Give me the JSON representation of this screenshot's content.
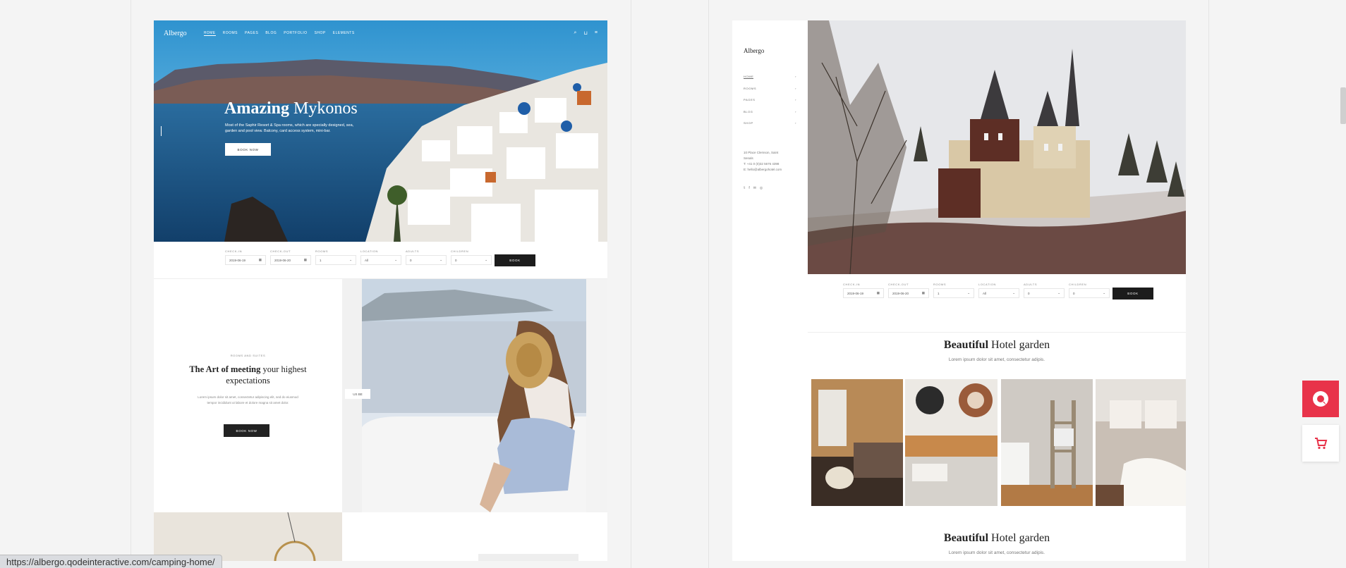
{
  "left_demo": {
    "nav": {
      "logo": "Albergo",
      "items": [
        "HOME",
        "ROOMS",
        "PAGES",
        "BLOG",
        "PORTFOLIO",
        "SHOP",
        "ELEMENTS"
      ]
    },
    "hero": {
      "title_bold": "Amazing",
      "title_rest": " Mykonos",
      "desc": "Most of the Saphir Resort & Spa rooms, which are specially designed, sea, garden and pool view. Balcony, card access system, mini-bar.",
      "button": "BOOK NOW"
    },
    "booking": {
      "fields": [
        {
          "label": "CHECK-IN",
          "value": "2019-06-19",
          "icon": "calendar-icon"
        },
        {
          "label": "CHECK-OUT",
          "value": "2019-06-20",
          "icon": "calendar-icon"
        },
        {
          "label": "ROOMS",
          "value": "1",
          "icon": "chevron-down-icon"
        },
        {
          "label": "LOCATION",
          "value": "All",
          "icon": "chevron-down-icon"
        },
        {
          "label": "ADULTS",
          "value": "0",
          "icon": "chevron-down-icon"
        },
        {
          "label": "CHILDREN",
          "value": "0",
          "icon": "chevron-down-icon"
        }
      ],
      "button": "BOOK"
    },
    "art": {
      "eyebrow": "ROOMS AND SUITES",
      "title_bold": "The Art of meeting",
      "title_rest": " your highest expectations",
      "text": "Lorem ipsum dolor sit amet, consectetur adipiscing elit, sed do eiusmod tempor incididunt ut labore et dolore magna sit amet dolor.",
      "button": "BOOK NOW"
    },
    "caption_chip": "US  BE"
  },
  "right_demo": {
    "logo": "Albergo",
    "menu": [
      "HOME",
      "ROOMS",
      "PAGES",
      "BLOG",
      "SHOP"
    ],
    "address": [
      "10 Place Clemson, Saint",
      "Senals",
      "T: +41 0 (0)32 5676 4398",
      "E: hello@albergohotel.com"
    ],
    "booking": {
      "fields": [
        {
          "label": "CHECK-IN",
          "value": "2019-06-19",
          "icon": "calendar-icon"
        },
        {
          "label": "CHECK-OUT",
          "value": "2019-06-20",
          "icon": "calendar-icon"
        },
        {
          "label": "ROOMS",
          "value": "1",
          "icon": "chevron-down-icon"
        },
        {
          "label": "LOCATION",
          "value": "All",
          "icon": "chevron-down-icon"
        },
        {
          "label": "ADULTS",
          "value": "0",
          "icon": "chevron-down-icon"
        },
        {
          "label": "CHILDREN",
          "value": "0",
          "icon": "chevron-down-icon"
        }
      ],
      "button": "BOOK"
    },
    "garden": {
      "title_bold": "Beautiful",
      "title_rest": " Hotel garden",
      "subtitle": "Lorem ipsum dolor sit amet, consectetur adipis."
    }
  },
  "status_url": "https://albergo.qodeinteractive.com/camping-home/",
  "colors": {
    "accent": "#e8334a",
    "dark": "#1c1c1c"
  }
}
